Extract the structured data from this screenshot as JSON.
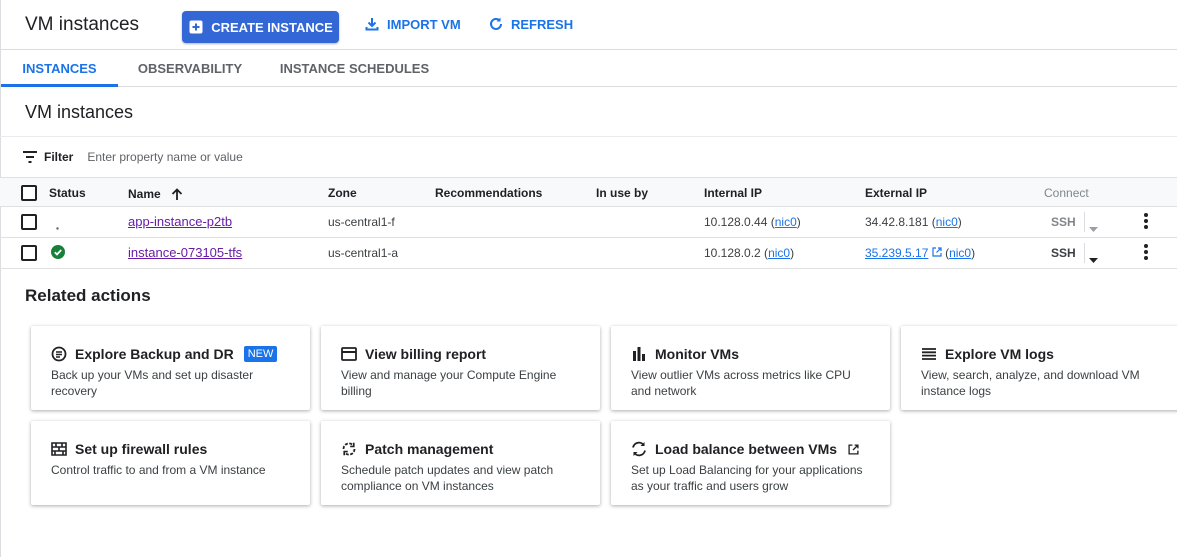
{
  "header": {
    "title": "VM instances",
    "create_label": "CREATE INSTANCE",
    "import_label": "IMPORT VM",
    "refresh_label": "REFRESH"
  },
  "tabs": [
    {
      "label": "INSTANCES",
      "active": true
    },
    {
      "label": "OBSERVABILITY",
      "active": false
    },
    {
      "label": "INSTANCE SCHEDULES",
      "active": false
    }
  ],
  "section_title": "VM instances",
  "filter": {
    "label": "Filter",
    "placeholder": "Enter property name or value"
  },
  "table": {
    "columns": {
      "status": "Status",
      "name": "Name",
      "zone": "Zone",
      "recommendations": "Recommendations",
      "in_use_by": "In use by",
      "internal_ip": "Internal IP",
      "external_ip": "External IP",
      "connect": "Connect"
    },
    "rows": [
      {
        "status": "pending",
        "name": "app-instance-p2tb",
        "zone": "us-central1-f",
        "internal_ip": "10.128.0.44",
        "internal_nic": "nic0",
        "external_ip": "34.42.8.181",
        "external_nic": "nic0",
        "connect": "SSH"
      },
      {
        "status": "running",
        "name": "instance-073105-tfs",
        "zone": "us-central1-a",
        "internal_ip": "10.128.0.2",
        "internal_nic": "nic0",
        "external_ip": "35.239.5.17",
        "external_nic": "nic0",
        "connect": "SSH"
      }
    ]
  },
  "related": {
    "title": "Related actions",
    "cards": [
      {
        "title": "Explore Backup and DR",
        "badge": "NEW",
        "desc": "Back up your VMs and set up disaster recovery",
        "icon": "backup-icon"
      },
      {
        "title": "View billing report",
        "desc": "View and manage your Compute Engine billing",
        "icon": "billing-icon"
      },
      {
        "title": "Monitor VMs",
        "desc": "View outlier VMs across metrics like CPU and network",
        "icon": "bar-chart-icon"
      },
      {
        "title": "Explore VM logs",
        "desc": "View, search, analyze, and download VM instance logs",
        "icon": "logs-icon"
      },
      {
        "title": "Set up firewall rules",
        "desc": "Control traffic to and from a VM instance",
        "icon": "firewall-icon"
      },
      {
        "title": "Patch management",
        "desc": "Schedule patch updates and view patch compliance on VM instances",
        "icon": "patch-icon"
      },
      {
        "title": "Load balance between VMs",
        "desc": "Set up Load Balancing for your applications as your traffic and users grow",
        "icon": "load-balance-icon"
      }
    ]
  },
  "colors": {
    "primary": "#3367d6",
    "link": "#1a73e8",
    "visited": "#681da8",
    "running": "#188038"
  }
}
